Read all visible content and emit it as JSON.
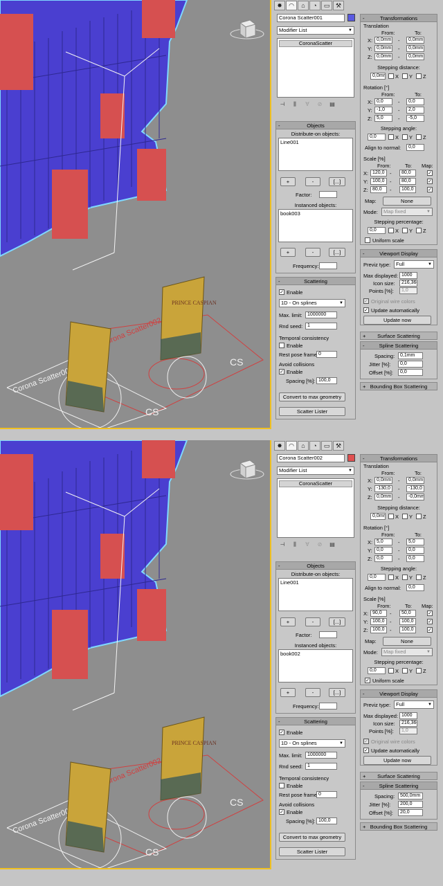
{
  "shots": [
    {
      "object_name": "Corona Scatter001",
      "object_color": "#5a5ae0",
      "modifier_list": "Modifier List",
      "stack_item": "CoronaScatter",
      "objects": {
        "header": "Objects",
        "distribute_label": "Distribute-on objects:",
        "distribute_items": [
          "Line001"
        ],
        "add": "+",
        "remove": "-",
        "more": "[...]",
        "factor_label": "Factor:",
        "instanced_label": "Instanced objects:",
        "instanced_items": [
          "book003"
        ],
        "frequency_label": "Frequency:"
      },
      "scattering": {
        "header": "Scattering",
        "enable": "Enable",
        "mode": "1D - On splines",
        "max_limit_label": "Max. limit:",
        "max_limit": "1000000",
        "rnd_seed_label": "Rnd seed:",
        "rnd_seed": "1",
        "temporal_header": "Temporal consistency",
        "temporal_enable": "Enable",
        "rest_pose_label": "Rest pose frame:",
        "rest_pose": "0",
        "avoid_header": "Avoid collisions",
        "avoid_enable": "Enable",
        "spacing_label": "Spacing [%]:",
        "spacing": "100,0",
        "convert_btn": "Convert to max geometry",
        "lister_btn": "Scatter Lister"
      },
      "transformations": {
        "header": "Transformations",
        "translation": "Translation",
        "from": "From:",
        "to": "To:",
        "x": "X:",
        "y": "Y:",
        "z": "Z:",
        "tx_from": "0,0mm",
        "tx_to": "0,0mm",
        "ty_from": "0,0mm",
        "ty_to": "0,0mm",
        "tz_from": "0,0mm",
        "tz_to": "0,0mm",
        "stepping_distance": "Stepping distance:",
        "step_dist": "0,0mm",
        "rotation": "Rotation [°]",
        "rx_from": "0,0",
        "rx_to": "0,0",
        "ry_from": "-1,0",
        "ry_to": "2,0",
        "rz_from": "5,0",
        "rz_to": "-5,0",
        "stepping_angle": "Stepping angle:",
        "step_angle": "0,0",
        "align_normal": "Align to normal:",
        "align_normal_val": "0,0",
        "scale": "Scale [%]",
        "map_col": "Map:",
        "sx_from": "120,0",
        "sx_to": "80,0",
        "sy_from": "100,0",
        "sy_to": "80,0",
        "sz_from": "80,0",
        "sz_to": "100,0",
        "map_label": "Map:",
        "map_value": "None",
        "mode_label": "Mode:",
        "mode_value": "Map fixed",
        "stepping_percentage": "Stepping percentage:",
        "step_pct": "0,0",
        "uniform_scale": "Uniform scale",
        "x_chk": "X",
        "y_chk": "Y",
        "z_chk": "Z"
      },
      "viewport_display": {
        "header": "Viewport Display",
        "previz_label": "Previz type:",
        "previz": "Full",
        "max_displayed_label": "Max displayed:",
        "max_displayed": "1000",
        "icon_size_label": "Icon size:",
        "icon_size": "216,366",
        "points_label": "Points [%]:",
        "points": "1,0",
        "original_wire": "Original wire colors",
        "update_auto": "Update automatically",
        "update_now": "Update now"
      },
      "surface_scattering": "Surface Scattering",
      "spline_scattering": {
        "header": "Spline Scattering",
        "spacing_label": "Spacing:",
        "spacing": "0,1mm",
        "jitter_label": "Jitter [%]:",
        "jitter": "0,0",
        "offset_label": "Offset [%]:",
        "offset": "0,0"
      },
      "bounding_box": "Bounding Box Scattering",
      "viewport_labels": {
        "scatter_a": "Corona Scatter001",
        "scatter_b": "Corona Scatter002",
        "cs": "CS",
        "book_title": "PRINCE CASPIAN"
      }
    },
    {
      "object_name": "Corona Scatter002",
      "object_color": "#e05050",
      "modifier_list": "Modifier List",
      "stack_item": "CoronaScatter",
      "objects": {
        "header": "Objects",
        "distribute_label": "Distribute-on objects:",
        "distribute_items": [
          "Line001"
        ],
        "add": "+",
        "remove": "-",
        "more": "[...]",
        "factor_label": "Factor:",
        "instanced_label": "Instanced objects:",
        "instanced_items": [
          "book002"
        ],
        "frequency_label": "Frequency:"
      },
      "scattering": {
        "header": "Scattering",
        "enable": "Enable",
        "mode": "1D - On splines",
        "max_limit_label": "Max. limit:",
        "max_limit": "1000000",
        "rnd_seed_label": "Rnd seed:",
        "rnd_seed": "1",
        "temporal_header": "Temporal consistency",
        "temporal_enable": "Enable",
        "rest_pose_label": "Rest pose frame:",
        "rest_pose": "0",
        "avoid_header": "Avoid collisions",
        "avoid_enable": "Enable",
        "spacing_label": "Spacing [%]:",
        "spacing": "100,0",
        "convert_btn": "Convert to max geometry",
        "lister_btn": "Scatter Lister"
      },
      "transformations": {
        "header": "Transformations",
        "translation": "Translation",
        "from": "From:",
        "to": "To:",
        "x": "X:",
        "y": "Y:",
        "z": "Z:",
        "tx_from": "0,0mm",
        "tx_to": "0,0mm",
        "ty_from": "-130,0",
        "ty_to": "-130,0",
        "tz_from": "0,0mm",
        "tz_to": "-0,0mm",
        "stepping_distance": "Stepping distance:",
        "step_dist": "0,0mm",
        "rotation": "Rotation [°]",
        "rx_from": "5,0",
        "rx_to": "5,0",
        "ry_from": "0,0",
        "ry_to": "0,0",
        "rz_from": "0,0",
        "rz_to": "0,0",
        "stepping_angle": "Stepping angle:",
        "step_angle": "0,0",
        "align_normal": "Align to normal:",
        "align_normal_val": "0,0",
        "scale": "Scale [%]",
        "map_col": "Map:",
        "sx_from": "90,0",
        "sx_to": "50,0",
        "sy_from": "100,0",
        "sy_to": "100,0",
        "sz_from": "100,0",
        "sz_to": "100,0",
        "map_label": "Map:",
        "map_value": "None",
        "mode_label": "Mode:",
        "mode_value": "Map fixed",
        "stepping_percentage": "Stepping percentage:",
        "step_pct": "0,0",
        "uniform_scale": "Uniform scale",
        "x_chk": "X",
        "y_chk": "Y",
        "z_chk": "Z"
      },
      "viewport_display": {
        "header": "Viewport Display",
        "previz_label": "Previz type:",
        "previz": "Full",
        "max_displayed_label": "Max displayed:",
        "max_displayed": "1000",
        "icon_size_label": "Icon size:",
        "icon_size": "216,366",
        "points_label": "Points [%]:",
        "points": "1,0",
        "original_wire": "Original wire colors",
        "update_auto": "Update automatically",
        "update_now": "Update now"
      },
      "surface_scattering": "Surface Scattering",
      "spline_scattering": {
        "header": "Spline Scattering",
        "spacing_label": "Spacing:",
        "spacing": "500,0mm",
        "jitter_label": "Jitter [%]:",
        "jitter": "200,0",
        "offset_label": "Offset [%]:",
        "offset": "20,0"
      },
      "bounding_box": "Bounding Box Scattering",
      "viewport_labels": {
        "scatter_a": "Corona Scatter001",
        "scatter_b": "Corona Scatter002",
        "cs": "CS",
        "book_title": "PRINCE CASPIAN"
      }
    }
  ],
  "tabs": [
    "create-icon",
    "modify-icon",
    "hierarchy-icon",
    "motion-icon",
    "display-icon",
    "utilities-icon"
  ]
}
